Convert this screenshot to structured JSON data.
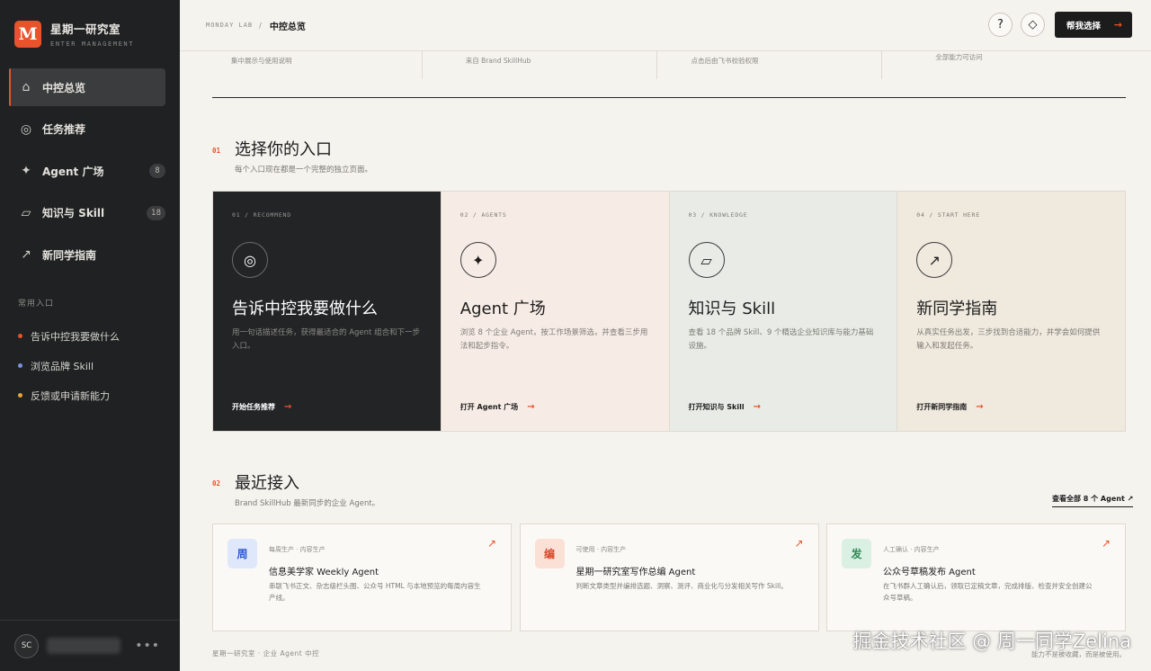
{
  "brand": {
    "logo_letter": "M",
    "name": "星期一研究室",
    "subtitle": "ENTER MANAGEMENT",
    "accent": "#e8532c"
  },
  "sidebar": {
    "items": [
      {
        "label": "中控总览",
        "icon": "home-icon",
        "glyph": "⌂",
        "badge": ""
      },
      {
        "label": "任务推荐",
        "icon": "target-icon",
        "glyph": "◎",
        "badge": ""
      },
      {
        "label": "Agent 广场",
        "icon": "sparkle-icon",
        "glyph": "✦",
        "badge": "8"
      },
      {
        "label": "知识与 Skill",
        "icon": "parallelogram-icon",
        "glyph": "▱",
        "badge": "18"
      },
      {
        "label": "新同学指南",
        "icon": "arrow-up-right-icon",
        "glyph": "↗",
        "badge": ""
      }
    ],
    "quick_title": "常用入口",
    "quick_links": [
      {
        "label": "告诉中控我要做什么",
        "color": "#e8532c"
      },
      {
        "label": "浏览品牌 Skill",
        "color": "#7a8fe0"
      },
      {
        "label": "反馈或申请新能力",
        "color": "#e3a53a"
      }
    ],
    "user": {
      "initials": "SC",
      "name": "",
      "more": "•••"
    }
  },
  "header": {
    "breadcrumb_root": "MONDAY LAB",
    "breadcrumb_sep": "/",
    "breadcrumb_current": "中控总览",
    "help_glyph": "?",
    "diamond_glyph": "◇",
    "primary_button": "帮我选择",
    "primary_arrow": "→"
  },
  "stats": [
    "集中展示与使用说明",
    "来自 Brand SkillHub",
    "点击后由飞书校验权限",
    "全部能力可访问"
  ],
  "entry_section": {
    "num": "01",
    "title": "选择你的入口",
    "subtitle": "每个入口现在都是一个完整的独立页面。",
    "cards": [
      {
        "tag": "01 / RECOMMEND",
        "icon": "target-icon",
        "glyph": "◎",
        "title": "告诉中控我要做什么",
        "desc": "用一句话描述任务，获得最适合的 Agent 组合和下一步入口。",
        "link": "开始任务推荐",
        "arrow": "→"
      },
      {
        "tag": "02 / AGENTS",
        "icon": "sparkle-icon",
        "glyph": "✦",
        "title": "Agent 广场",
        "desc": "浏览 8 个企业 Agent，按工作场景筛选，并查看三步用法和起步指令。",
        "link": "打开 Agent 广场",
        "arrow": "→"
      },
      {
        "tag": "03 / KNOWLEDGE",
        "icon": "parallelogram-icon",
        "glyph": "▱",
        "title": "知识与 Skill",
        "desc": "查看 18 个品牌 Skill、9 个精选企业知识库与能力基础设施。",
        "link": "打开知识与 Skill",
        "arrow": "→"
      },
      {
        "tag": "04 / START HERE",
        "icon": "arrow-up-right-icon",
        "glyph": "↗",
        "title": "新同学指南",
        "desc": "从真实任务出发，三步找到合适能力，并学会如何提供输入和发起任务。",
        "link": "打开新同学指南",
        "arrow": "→"
      }
    ]
  },
  "recent_section": {
    "num": "02",
    "title": "最近接入",
    "subtitle": "Brand SkillHub 最新同步的企业 Agent。",
    "view_all": "查看全部 8 个 Agent ↗",
    "agents": [
      {
        "avatar": "周",
        "avatar_bg": "#dfe8fb",
        "avatar_color": "#2f5bd1",
        "tag": "每周生产 · 内容生产",
        "name": "信息美学家 Weekly Agent",
        "desc": "串联飞书正文、杂志级栏头图、公众号 HTML 与本地预览的每周内容生产线。",
        "arrow": "↗"
      },
      {
        "avatar": "编",
        "avatar_bg": "#fbe0d6",
        "avatar_color": "#d8472a",
        "tag": "可使用 · 内容生产",
        "name": "星期一研究室写作总编 Agent",
        "desc": "判断文章类型并编排选题、洞察、测评、商业化与分发相关写作 Skill。",
        "arrow": "↗"
      },
      {
        "avatar": "发",
        "avatar_bg": "#daf0e3",
        "avatar_color": "#2f8a58",
        "tag": "人工确认 · 内容生产",
        "name": "公众号草稿发布 Agent",
        "desc": "在飞书群人工确认后，领取已定稿文章，完成排版、检查并安全创建公众号草稿。",
        "arrow": "↗"
      }
    ]
  },
  "footer": {
    "left": "星期一研究室 · 企业 Agent 中控",
    "right": "能力不是被收藏，而是被使用。"
  },
  "watermark": "掘金技术社区 @ 周一同学Zelina"
}
